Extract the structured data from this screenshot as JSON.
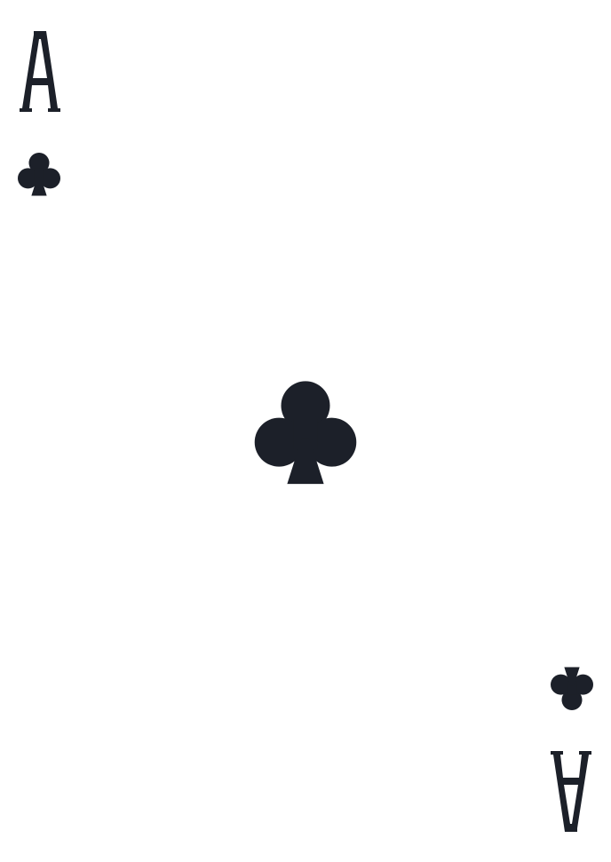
{
  "card": {
    "rank": "A",
    "suit_icon": "club-icon",
    "ink_color": "#1c2029",
    "background_color": "#ffffff"
  }
}
